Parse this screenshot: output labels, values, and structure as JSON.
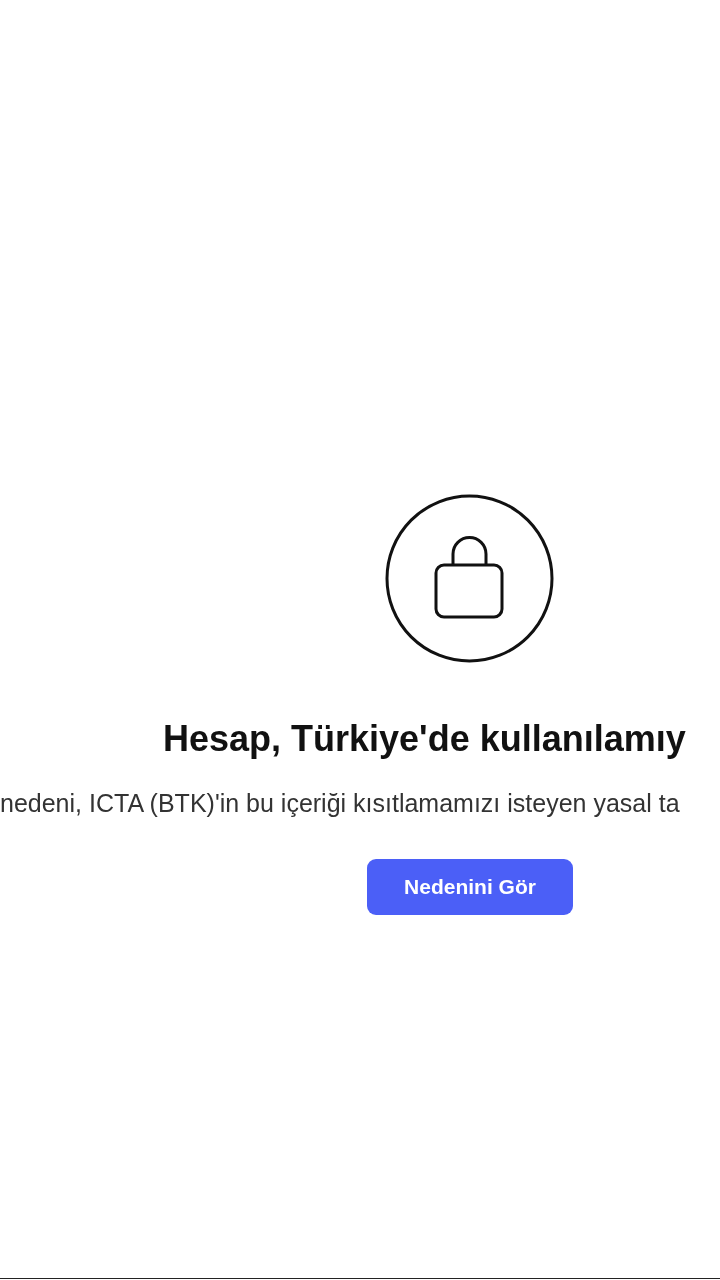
{
  "title": "Hesap, Türkiye'de kullanılamıy",
  "message": "nedeni, ICTA (BTK)'in bu içeriği kısıtlamamızı isteyen yasal ta",
  "button": "Nedenini Gör"
}
